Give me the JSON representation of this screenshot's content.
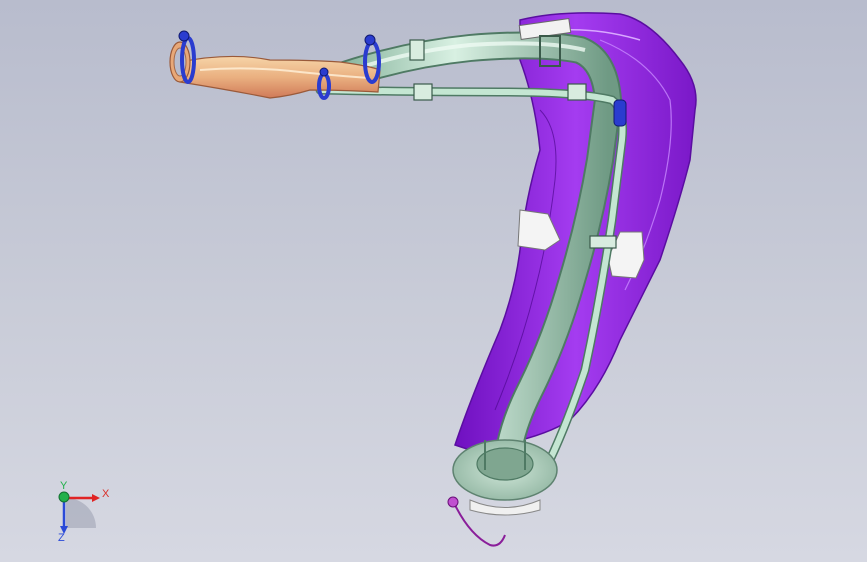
{
  "viewer": {
    "background_top": "#b8bccd",
    "background_bottom": "#d6d8e2"
  },
  "model": {
    "colors": {
      "tank": "#9b28e8",
      "tank_edge": "#6a14b0",
      "pipe": "#b8dcc8",
      "pipe_edge": "#4f7a64",
      "hose": "#e8a878",
      "clamp": "#2a3ccf",
      "bracket": "#f2f2f2"
    }
  },
  "triad": {
    "x_label": "X",
    "y_label": "Y",
    "z_label": "Z",
    "x_color": "#e02424",
    "y_color": "#22b04a",
    "z_color": "#2a4ad8"
  }
}
